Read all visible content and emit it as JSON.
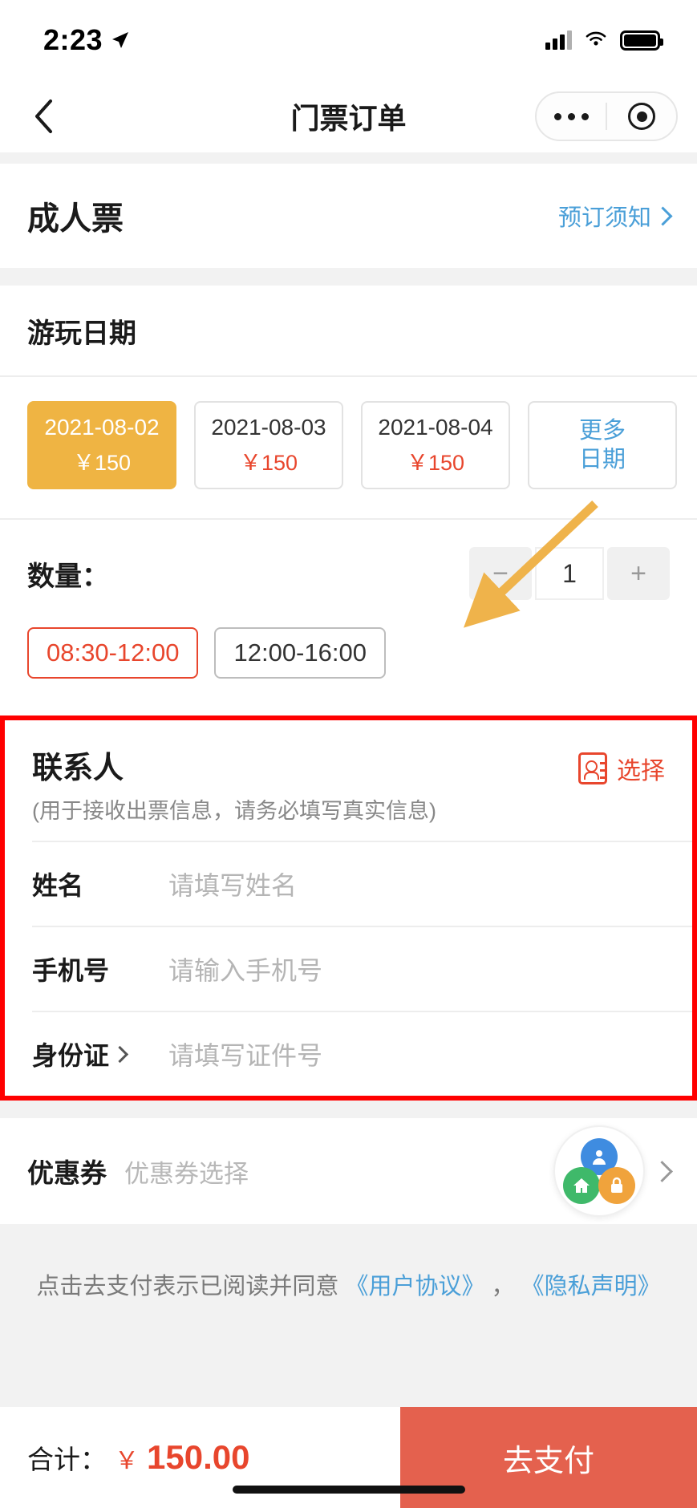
{
  "status_bar": {
    "time": "2:23",
    "location_icon": "location-arrow-icon",
    "signal_icon": "cellular-signal-icon",
    "wifi_icon": "wifi-icon",
    "battery_icon": "battery-full-icon"
  },
  "nav": {
    "back_icon": "back-chevron-icon",
    "title": "门票订单",
    "more_icon": "more-dots-icon",
    "target_icon": "target-circle-icon"
  },
  "ticket": {
    "name": "成人票",
    "notice_label": "预订须知",
    "notice_chevron": "chevron-right-icon"
  },
  "date_section": {
    "title": "游玩日期",
    "dates": [
      {
        "date": "2021-08-02",
        "price": "￥150",
        "selected": true
      },
      {
        "date": "2021-08-03",
        "price": "￥150",
        "selected": false
      },
      {
        "date": "2021-08-04",
        "price": "￥150",
        "selected": false
      }
    ],
    "more_line1": "更多",
    "more_line2": "日期"
  },
  "quantity": {
    "label": "数量：",
    "minus_label": "−",
    "value": "1",
    "plus_label": "+"
  },
  "time_slots": [
    {
      "label": "08:30-12:00",
      "selected": true
    },
    {
      "label": "12:00-16:00",
      "selected": false
    }
  ],
  "contact": {
    "title": "联系人",
    "subtitle": "(用于接收出票信息，请务必填写真实信息)",
    "pick_icon": "contact-card-icon",
    "pick_label": "选择",
    "fields": [
      {
        "label": "姓名",
        "placeholder": "请填写姓名",
        "has_chevron": false
      },
      {
        "label": "手机号",
        "placeholder": "请输入手机号",
        "has_chevron": false
      },
      {
        "label": "身份证",
        "placeholder": "请填写证件号",
        "has_chevron": true
      }
    ],
    "highlight_color": "#ff0000",
    "arrow_color": "#efb34b"
  },
  "coupon": {
    "label": "优惠券",
    "placeholder": "优惠券选择",
    "chevron": "chevron-right-icon",
    "float_ball": {
      "user_icon": "user-avatar-icon",
      "home_icon": "home-icon",
      "lock_icon": "lock-icon"
    }
  },
  "agreement": {
    "prefix": "点击去支付表示已阅读并同意",
    "link1": "《用户协议》",
    "separator": "，",
    "link2": "《隐私声明》"
  },
  "bottom": {
    "total_label": "合计：",
    "currency": "￥",
    "amount": "150.00",
    "pay_label": "去支付"
  },
  "colors": {
    "accent_orange": "#efb443",
    "accent_red": "#e8462d",
    "link_blue": "#4a9fd8",
    "pay_button": "#e4614e",
    "page_bg": "#f2f2f2"
  }
}
